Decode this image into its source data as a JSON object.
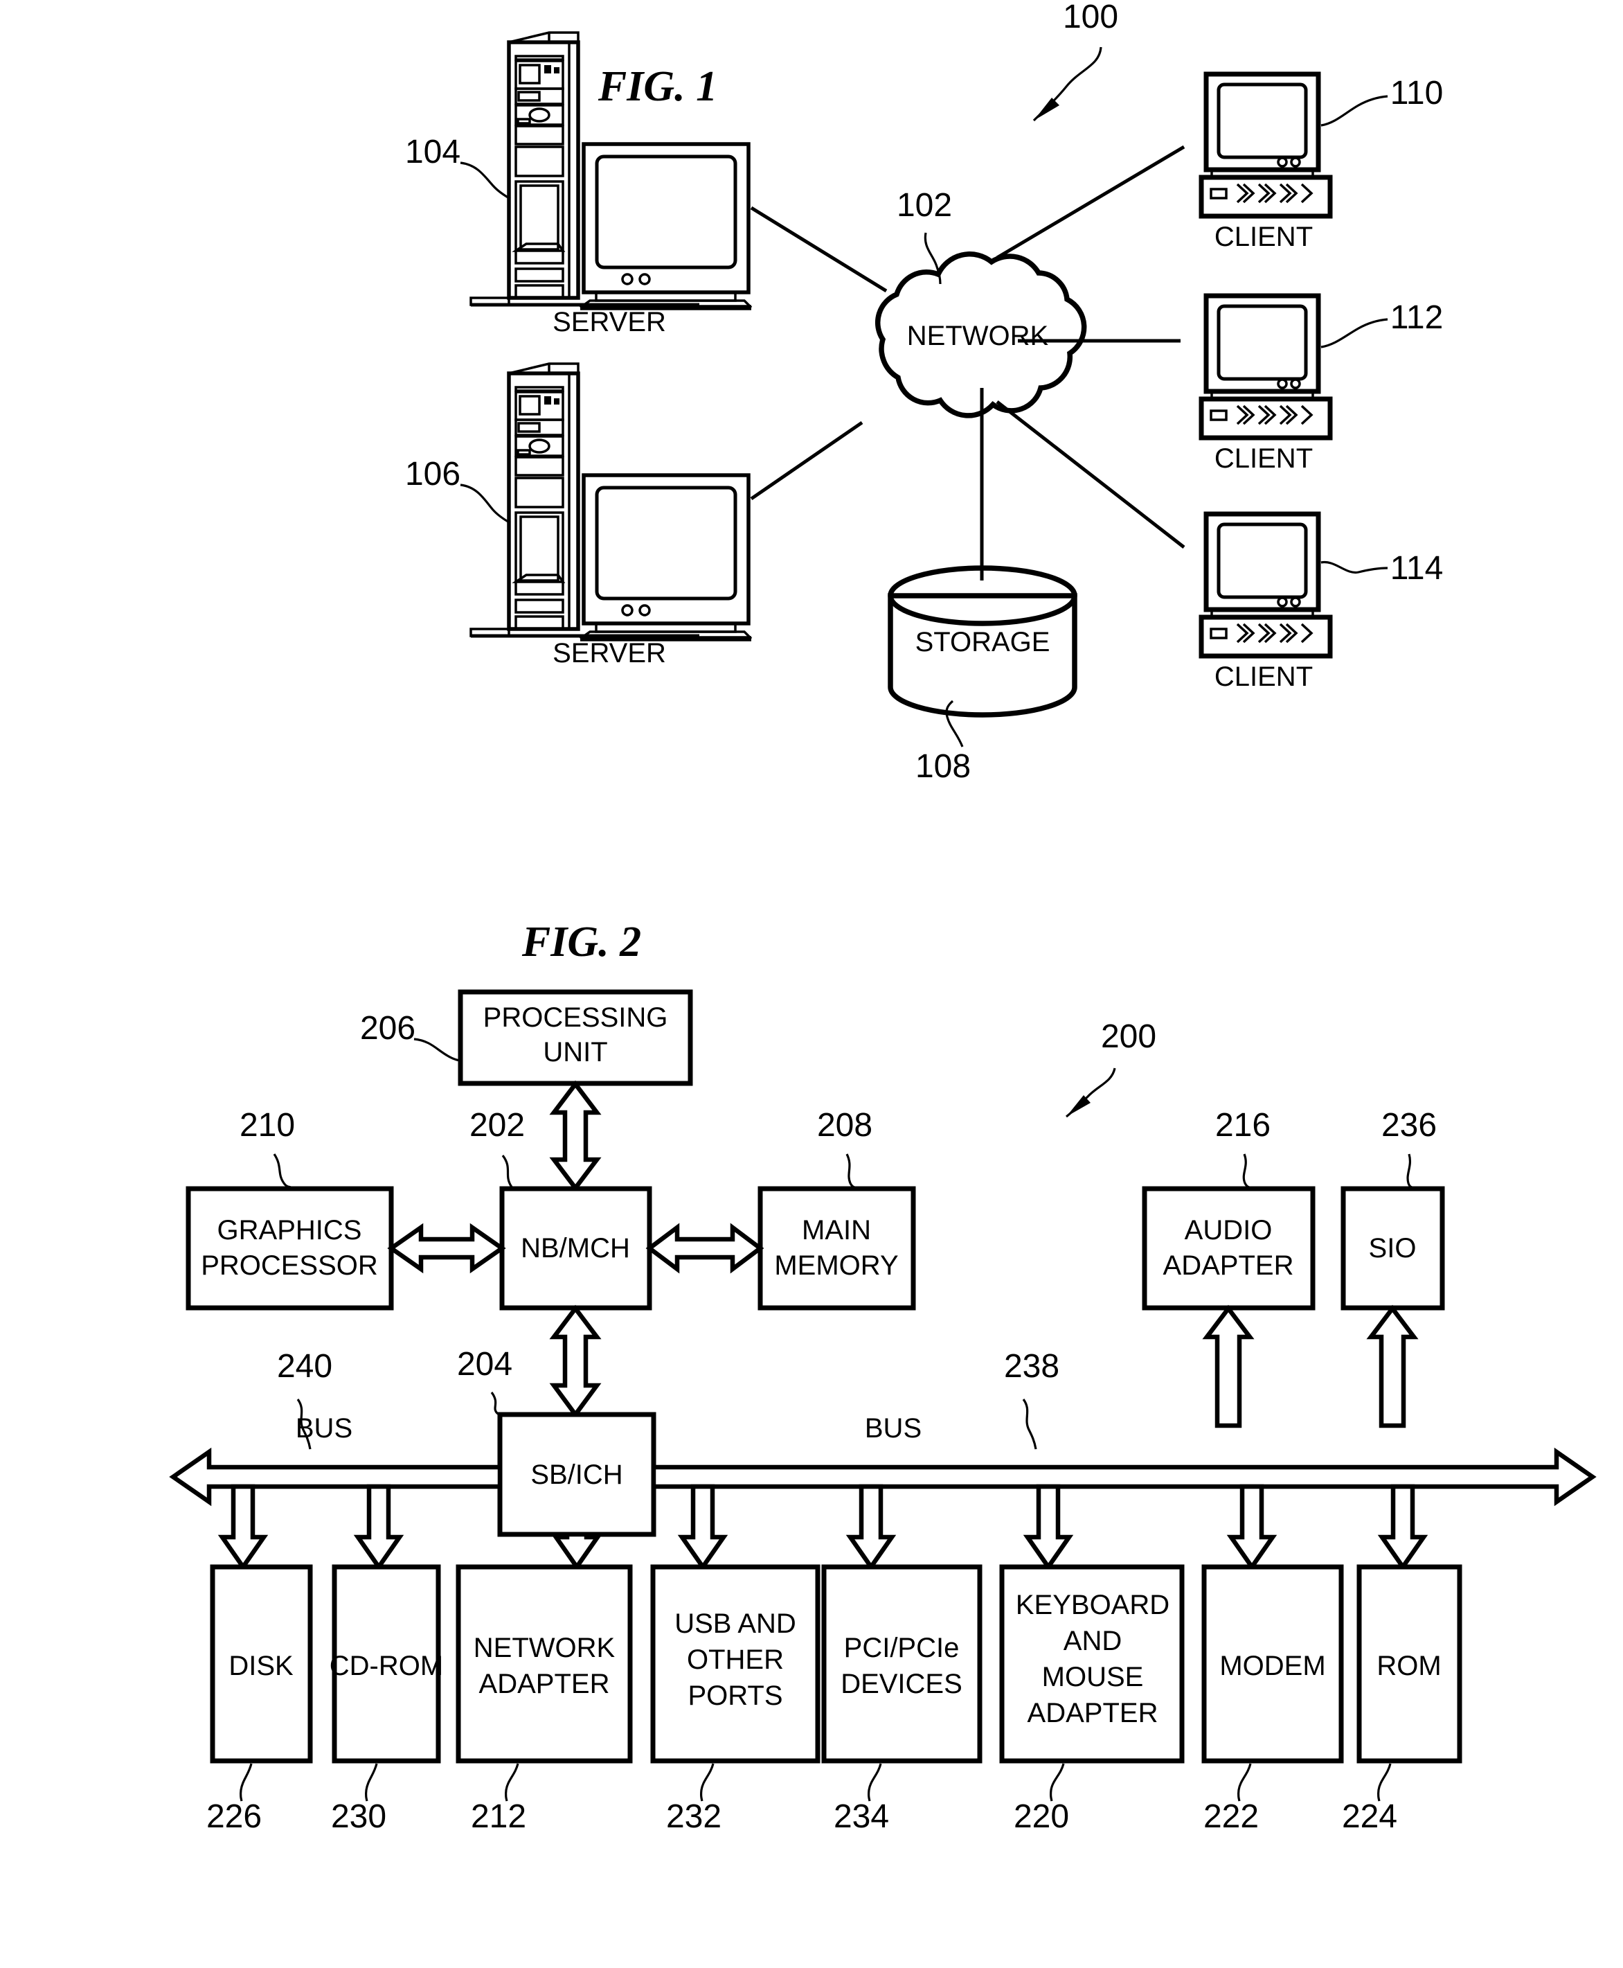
{
  "figures": [
    {
      "id": "fig1",
      "title": "FIG. 1",
      "system_ref": "100",
      "nodes": {
        "server_top": {
          "label": "SERVER",
          "ref": "104"
        },
        "server_bottom": {
          "label": "SERVER",
          "ref": "106"
        },
        "network": {
          "label": "NETWORK",
          "ref": "102"
        },
        "storage": {
          "label": "STORAGE",
          "ref": "108"
        },
        "client_1": {
          "label": "CLIENT",
          "ref": "110"
        },
        "client_2": {
          "label": "CLIENT",
          "ref": "112"
        },
        "client_3": {
          "label": "CLIENT",
          "ref": "114"
        }
      }
    },
    {
      "id": "fig2",
      "title": "FIG. 2",
      "system_ref": "200",
      "blocks": {
        "processing_unit": {
          "label_line1": "PROCESSING",
          "label_line2": "UNIT",
          "ref": "206"
        },
        "nb_mch": {
          "label": "NB/MCH",
          "ref": "202"
        },
        "graphics_processor": {
          "label_line1": "GRAPHICS",
          "label_line2": "PROCESSOR",
          "ref": "210"
        },
        "main_memory": {
          "label_line1": "MAIN",
          "label_line2": "MEMORY",
          "ref": "208"
        },
        "audio_adapter": {
          "label_line1": "AUDIO",
          "label_line2": "ADAPTER",
          "ref": "216"
        },
        "sio": {
          "label": "SIO",
          "ref": "236"
        },
        "sb_ich": {
          "label": "SB/ICH",
          "ref": "204"
        },
        "bus_left": {
          "label": "BUS",
          "ref": "240"
        },
        "bus_right": {
          "label": "BUS",
          "ref": "238"
        }
      },
      "devices": [
        {
          "lines": [
            "DISK"
          ],
          "ref": "226"
        },
        {
          "lines": [
            "CD-ROM"
          ],
          "ref": "230"
        },
        {
          "lines": [
            "NETWORK",
            "ADAPTER"
          ],
          "ref": "212"
        },
        {
          "lines": [
            "USB AND",
            "OTHER",
            "PORTS"
          ],
          "ref": "232"
        },
        {
          "lines": [
            "PCI/PCIe",
            "DEVICES"
          ],
          "ref": "234"
        },
        {
          "lines": [
            "KEYBOARD",
            "AND",
            "MOUSE",
            "ADAPTER"
          ],
          "ref": "220"
        },
        {
          "lines": [
            "MODEM"
          ],
          "ref": "222"
        },
        {
          "lines": [
            "ROM"
          ],
          "ref": "224"
        }
      ]
    }
  ],
  "colors": {
    "ink": "#000000",
    "paper": "#ffffff"
  }
}
